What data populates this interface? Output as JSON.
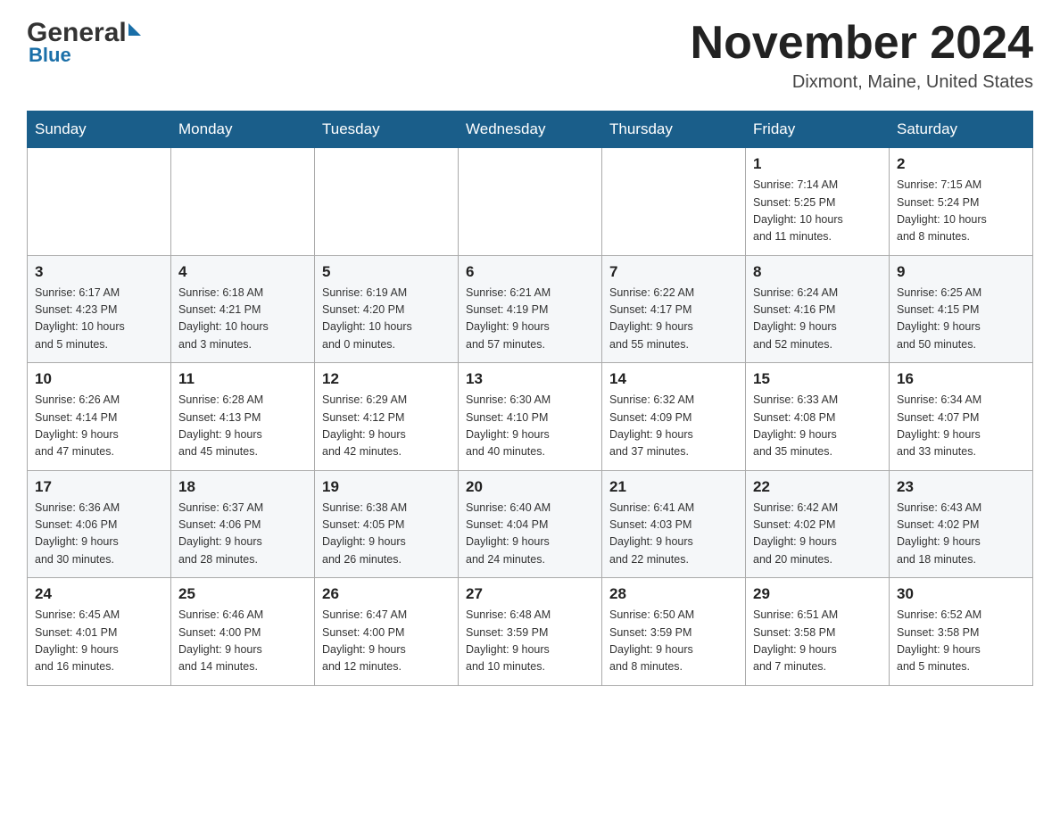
{
  "header": {
    "logo_general": "General",
    "logo_blue": "Blue",
    "month_title": "November 2024",
    "location": "Dixmont, Maine, United States"
  },
  "weekdays": [
    "Sunday",
    "Monday",
    "Tuesday",
    "Wednesday",
    "Thursday",
    "Friday",
    "Saturday"
  ],
  "weeks": [
    {
      "days": [
        {
          "number": "",
          "info": ""
        },
        {
          "number": "",
          "info": ""
        },
        {
          "number": "",
          "info": ""
        },
        {
          "number": "",
          "info": ""
        },
        {
          "number": "",
          "info": ""
        },
        {
          "number": "1",
          "info": "Sunrise: 7:14 AM\nSunset: 5:25 PM\nDaylight: 10 hours\nand 11 minutes."
        },
        {
          "number": "2",
          "info": "Sunrise: 7:15 AM\nSunset: 5:24 PM\nDaylight: 10 hours\nand 8 minutes."
        }
      ]
    },
    {
      "days": [
        {
          "number": "3",
          "info": "Sunrise: 6:17 AM\nSunset: 4:23 PM\nDaylight: 10 hours\nand 5 minutes."
        },
        {
          "number": "4",
          "info": "Sunrise: 6:18 AM\nSunset: 4:21 PM\nDaylight: 10 hours\nand 3 minutes."
        },
        {
          "number": "5",
          "info": "Sunrise: 6:19 AM\nSunset: 4:20 PM\nDaylight: 10 hours\nand 0 minutes."
        },
        {
          "number": "6",
          "info": "Sunrise: 6:21 AM\nSunset: 4:19 PM\nDaylight: 9 hours\nand 57 minutes."
        },
        {
          "number": "7",
          "info": "Sunrise: 6:22 AM\nSunset: 4:17 PM\nDaylight: 9 hours\nand 55 minutes."
        },
        {
          "number": "8",
          "info": "Sunrise: 6:24 AM\nSunset: 4:16 PM\nDaylight: 9 hours\nand 52 minutes."
        },
        {
          "number": "9",
          "info": "Sunrise: 6:25 AM\nSunset: 4:15 PM\nDaylight: 9 hours\nand 50 minutes."
        }
      ]
    },
    {
      "days": [
        {
          "number": "10",
          "info": "Sunrise: 6:26 AM\nSunset: 4:14 PM\nDaylight: 9 hours\nand 47 minutes."
        },
        {
          "number": "11",
          "info": "Sunrise: 6:28 AM\nSunset: 4:13 PM\nDaylight: 9 hours\nand 45 minutes."
        },
        {
          "number": "12",
          "info": "Sunrise: 6:29 AM\nSunset: 4:12 PM\nDaylight: 9 hours\nand 42 minutes."
        },
        {
          "number": "13",
          "info": "Sunrise: 6:30 AM\nSunset: 4:10 PM\nDaylight: 9 hours\nand 40 minutes."
        },
        {
          "number": "14",
          "info": "Sunrise: 6:32 AM\nSunset: 4:09 PM\nDaylight: 9 hours\nand 37 minutes."
        },
        {
          "number": "15",
          "info": "Sunrise: 6:33 AM\nSunset: 4:08 PM\nDaylight: 9 hours\nand 35 minutes."
        },
        {
          "number": "16",
          "info": "Sunrise: 6:34 AM\nSunset: 4:07 PM\nDaylight: 9 hours\nand 33 minutes."
        }
      ]
    },
    {
      "days": [
        {
          "number": "17",
          "info": "Sunrise: 6:36 AM\nSunset: 4:06 PM\nDaylight: 9 hours\nand 30 minutes."
        },
        {
          "number": "18",
          "info": "Sunrise: 6:37 AM\nSunset: 4:06 PM\nDaylight: 9 hours\nand 28 minutes."
        },
        {
          "number": "19",
          "info": "Sunrise: 6:38 AM\nSunset: 4:05 PM\nDaylight: 9 hours\nand 26 minutes."
        },
        {
          "number": "20",
          "info": "Sunrise: 6:40 AM\nSunset: 4:04 PM\nDaylight: 9 hours\nand 24 minutes."
        },
        {
          "number": "21",
          "info": "Sunrise: 6:41 AM\nSunset: 4:03 PM\nDaylight: 9 hours\nand 22 minutes."
        },
        {
          "number": "22",
          "info": "Sunrise: 6:42 AM\nSunset: 4:02 PM\nDaylight: 9 hours\nand 20 minutes."
        },
        {
          "number": "23",
          "info": "Sunrise: 6:43 AM\nSunset: 4:02 PM\nDaylight: 9 hours\nand 18 minutes."
        }
      ]
    },
    {
      "days": [
        {
          "number": "24",
          "info": "Sunrise: 6:45 AM\nSunset: 4:01 PM\nDaylight: 9 hours\nand 16 minutes."
        },
        {
          "number": "25",
          "info": "Sunrise: 6:46 AM\nSunset: 4:00 PM\nDaylight: 9 hours\nand 14 minutes."
        },
        {
          "number": "26",
          "info": "Sunrise: 6:47 AM\nSunset: 4:00 PM\nDaylight: 9 hours\nand 12 minutes."
        },
        {
          "number": "27",
          "info": "Sunrise: 6:48 AM\nSunset: 3:59 PM\nDaylight: 9 hours\nand 10 minutes."
        },
        {
          "number": "28",
          "info": "Sunrise: 6:50 AM\nSunset: 3:59 PM\nDaylight: 9 hours\nand 8 minutes."
        },
        {
          "number": "29",
          "info": "Sunrise: 6:51 AM\nSunset: 3:58 PM\nDaylight: 9 hours\nand 7 minutes."
        },
        {
          "number": "30",
          "info": "Sunrise: 6:52 AM\nSunset: 3:58 PM\nDaylight: 9 hours\nand 5 minutes."
        }
      ]
    }
  ]
}
